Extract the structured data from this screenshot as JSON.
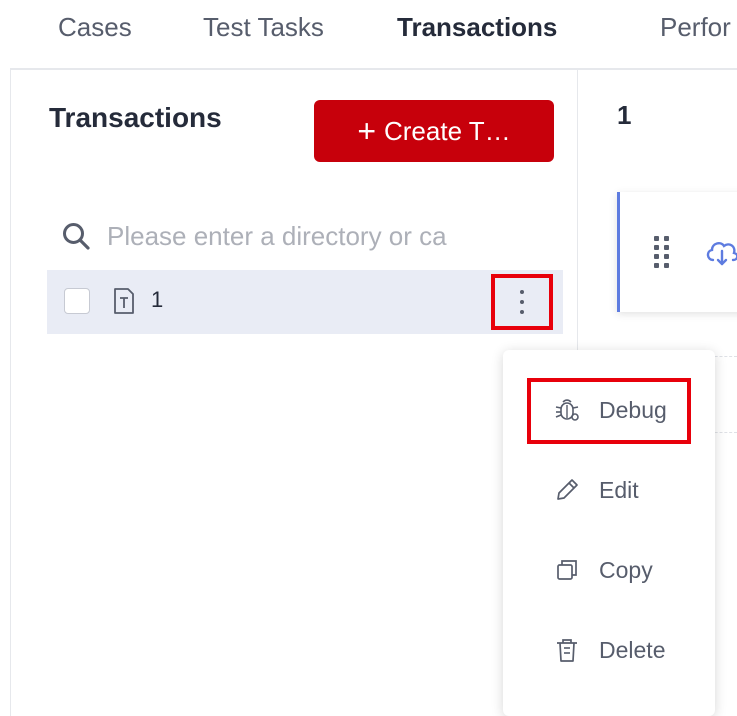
{
  "tabs": [
    {
      "label": "Cases"
    },
    {
      "label": "Test Tasks"
    },
    {
      "label": "Transactions"
    },
    {
      "label": "Perfor"
    }
  ],
  "active_tab_index": 2,
  "left_panel": {
    "title": "Transactions",
    "create_button_label": "Create T…",
    "search_placeholder": "Please enter a directory or ca",
    "tree_items": [
      {
        "label": "1",
        "icon": "transaction-file-icon",
        "checked": false
      }
    ]
  },
  "right_panel": {
    "title": "1",
    "step_icons": [
      "drag-handle-icon",
      "cloud-download-icon"
    ]
  },
  "context_menu": {
    "items": [
      {
        "label": "Debug",
        "icon": "bug-icon"
      },
      {
        "label": "Edit",
        "icon": "pencil-icon"
      },
      {
        "label": "Copy",
        "icon": "copy-icon"
      },
      {
        "label": "Delete",
        "icon": "trash-icon"
      }
    ]
  },
  "colors": {
    "brand_red": "#c7000b",
    "highlight_red": "#e8000b",
    "selected_row_bg": "#e9ecf5",
    "accent_blue": "#5e7ce0"
  }
}
